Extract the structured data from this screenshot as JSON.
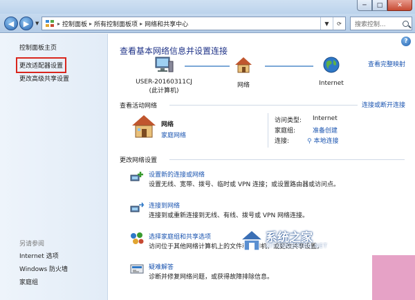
{
  "window": {
    "controls": {
      "minimize": "─",
      "maximize": "□",
      "close": "✕"
    }
  },
  "address": {
    "crumbs": [
      "控制面板",
      "所有控制面板项",
      "网络和共享中心"
    ],
    "search_placeholder": "搜索控制..."
  },
  "sidebar": {
    "home": "控制面板主页",
    "change_adapter": "更改适配器设置",
    "advanced_sharing": "更改高级共享设置",
    "see_also_title": "另请参阅",
    "see_also": [
      "Internet 选项",
      "Windows 防火墙",
      "家庭组"
    ]
  },
  "main": {
    "title": "查看基本网络信息并设置连接",
    "full_map": "查看完整映射",
    "map": {
      "computer_name": "USER-20160311CJ",
      "computer_sub": "(此计算机)",
      "network": "网络",
      "internet": "Internet"
    },
    "active_title": "查看活动网络",
    "connect_disconnect": "连接或断开连接",
    "active": {
      "name": "网络",
      "type": "家庭网络",
      "access_label": "访问类型:",
      "access_value": "Internet",
      "homegroup_label": "家庭组:",
      "homegroup_value": "准备创建",
      "conn_label": "连接:",
      "conn_value": "本地连接"
    },
    "change_title": "更改网络设置",
    "tasks": [
      {
        "title": "设置新的连接或网络",
        "desc": "设置无线、宽带、拨号、临时或 VPN 连接；或设置路由器或访问点。"
      },
      {
        "title": "连接到网络",
        "desc": "连接到或重新连接到无线、有线、拨号或 VPN 网络连接。"
      },
      {
        "title": "选择家庭组和共享选项",
        "desc": "访问位于其他网络计算机上的文件和打印机，或更改共享设置。"
      },
      {
        "title": "疑难解答",
        "desc": "诊断并修复网络问题，或获得故障排除信息。"
      }
    ]
  },
  "watermark": {
    "text": "系统之家",
    "url": "XITONGZHIJIA.NET"
  },
  "colors": {
    "link": "#1a54b0",
    "title": "#1e3287",
    "highlight": "#d9251c"
  }
}
